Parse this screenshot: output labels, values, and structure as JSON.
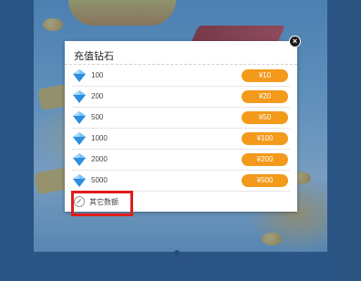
{
  "dialog": {
    "title": "充值钻石",
    "close": "×",
    "items": [
      {
        "amount": "100",
        "price": "¥10"
      },
      {
        "amount": "200",
        "price": "¥20"
      },
      {
        "amount": "500",
        "price": "¥50"
      },
      {
        "amount": "1000",
        "price": "¥100"
      },
      {
        "amount": "2000",
        "price": "¥200"
      },
      {
        "amount": "5000",
        "price": "¥500"
      }
    ],
    "other_label": "其它数额"
  },
  "colors": {
    "price_button": "#f39a1b",
    "highlight": "#e01b1b",
    "gem": "#2e8fe0"
  },
  "icons": {
    "gem": "diamond-icon",
    "other": "pencil-icon",
    "close": "close-icon"
  }
}
